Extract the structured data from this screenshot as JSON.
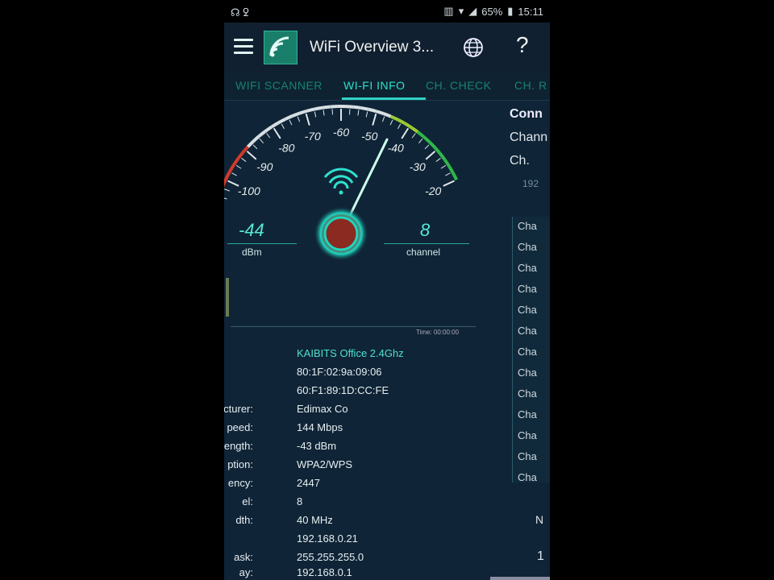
{
  "status_bar": {
    "left_icons": "☊ ꝿ",
    "battery_pct": "65%",
    "time": "15:11"
  },
  "app": {
    "title": "WiFi Overview 3..."
  },
  "tabs": [
    {
      "label": "WIFI SCANNER",
      "active": false
    },
    {
      "label": "WI-FI INFO",
      "active": true
    },
    {
      "label": "CH. CHECK",
      "active": false
    },
    {
      "label": "CH. R",
      "active": false
    }
  ],
  "gauge": {
    "ticks": [
      "-100",
      "-90",
      "-80",
      "-70",
      "-60",
      "-50",
      "-40",
      "-30",
      "-20"
    ],
    "signal_value": "-44",
    "signal_unit": "dBm",
    "channel_value": "8",
    "channel_unit": "channel",
    "needle_dbm": -44,
    "time_label": "Time: 00:00:00"
  },
  "right_panel": {
    "heading": "Conn",
    "line1": "Chann",
    "line2": "Ch.",
    "line3": "192",
    "rows": [
      "Cha",
      "Cha",
      "Cha",
      "Cha",
      "Cha",
      "Cha",
      "Cha",
      "Cha",
      "Cha",
      "Cha",
      "Cha",
      "Cha",
      "Cha"
    ],
    "footer1": "N",
    "footer2": "1"
  },
  "info": {
    "rows": [
      {
        "label": "",
        "value": "KAIBITS Office 2.4Ghz"
      },
      {
        "label": "",
        "value": "80:1F:02:9a:09:06"
      },
      {
        "label": "",
        "value": "60:F1:89:1D:CC:FE"
      },
      {
        "label": "facturer:",
        "value": "Edimax Co"
      },
      {
        "label": "peed:",
        "value": "144 Mbps"
      },
      {
        "label": "trength:",
        "value": "-43 dBm"
      },
      {
        "label": "ption:",
        "value": "WPA2/WPS"
      },
      {
        "label": "ency:",
        "value": "2447"
      },
      {
        "label": "el:",
        "value": "8"
      },
      {
        "label": "dth:",
        "value": "40 MHz"
      },
      {
        "label": "",
        "value": "192.168.0.21"
      },
      {
        "label": "ask:",
        "value": "255.255.255.0"
      },
      {
        "label": "ay:",
        "value": "192.168.0.1"
      }
    ]
  },
  "colors": {
    "accent": "#2fd3c5",
    "background": "#0f2436",
    "ssid": "#4ee0d0"
  }
}
